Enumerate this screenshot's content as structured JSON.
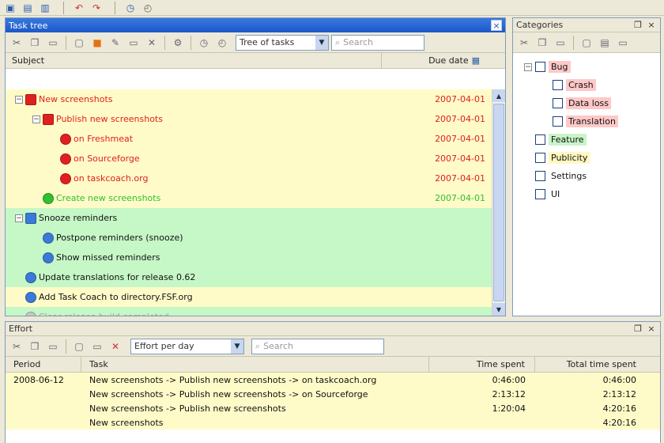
{
  "colors": {
    "overdue": "#e02020",
    "overdue_bg": "#fffbc8",
    "completed": "#30c030",
    "active_bg": "#c6f7c6",
    "inactive_bg": "#fffbc8",
    "task_blue": "#3a7ad8",
    "bug_bg": "#ffc8c8",
    "feature_bg": "#c8f5c8",
    "publicity_bg": "#fff8c0"
  },
  "main_toolbar": {
    "icons": [
      "save-icon",
      "open-icon",
      "print-icon",
      "undo-icon",
      "redo-icon",
      "clock-icon",
      "stopwatch-icon"
    ]
  },
  "task_tree": {
    "title": "Task tree",
    "view_select": "Tree of tasks",
    "search_placeholder": "Search",
    "col_subject": "Subject",
    "col_due": "Due date",
    "tasks": [
      {
        "label": "New screenshots",
        "due": "2007-04-01",
        "indent": 0,
        "expander": "−",
        "icon": "red-folder",
        "state": "overdue"
      },
      {
        "label": "Publish new screenshots",
        "due": "2007-04-01",
        "indent": 1,
        "expander": "−",
        "icon": "red-folder",
        "state": "overdue"
      },
      {
        "label": "on Freshmeat",
        "due": "2007-04-01",
        "indent": 2,
        "expander": "",
        "icon": "red",
        "state": "overdue"
      },
      {
        "label": "on Sourceforge",
        "due": "2007-04-01",
        "indent": 2,
        "expander": "",
        "icon": "red",
        "state": "overdue"
      },
      {
        "label": "on taskcoach.org",
        "due": "2007-04-01",
        "indent": 2,
        "expander": "",
        "icon": "red",
        "state": "overdue"
      },
      {
        "label": "Create new screenshots",
        "due": "2007-04-01",
        "indent": 1,
        "expander": "",
        "icon": "green",
        "state": "completed"
      },
      {
        "label": "Snooze reminders",
        "due": "",
        "indent": 0,
        "expander": "−",
        "icon": "blue-folder",
        "state": "active"
      },
      {
        "label": "Postpone reminders (snooze)",
        "due": "",
        "indent": 1,
        "expander": "",
        "icon": "blue",
        "state": "active"
      },
      {
        "label": "Show missed reminders",
        "due": "",
        "indent": 1,
        "expander": "",
        "icon": "blue",
        "state": "active"
      },
      {
        "label": "Update translations for release 0.62",
        "due": "",
        "indent": 0,
        "expander": "",
        "icon": "blue",
        "state": "active"
      },
      {
        "label": "Add Task Coach to directory.FSF.org",
        "due": "",
        "indent": 0,
        "expander": "",
        "icon": "blue",
        "state": "inactive"
      },
      {
        "label": "Clear release build completed",
        "due": "",
        "indent": 0,
        "expander": "",
        "icon": "grey",
        "state": "faded"
      }
    ]
  },
  "categories": {
    "title": "Categories",
    "items": [
      {
        "label": "Bug",
        "indent": 0,
        "expander": "−",
        "bg": "#ffc8c8"
      },
      {
        "label": "Crash",
        "indent": 1,
        "expander": "",
        "bg": "#ffc8c8"
      },
      {
        "label": "Data loss",
        "indent": 1,
        "expander": "",
        "bg": "#ffc8c8"
      },
      {
        "label": "Translation",
        "indent": 1,
        "expander": "",
        "bg": "#ffc8c8"
      },
      {
        "label": "Feature",
        "indent": 0,
        "expander": "",
        "bg": "#c8f5c8"
      },
      {
        "label": "Publicity",
        "indent": 0,
        "expander": "",
        "bg": "#fff8c0"
      },
      {
        "label": "Settings",
        "indent": 0,
        "expander": "",
        "bg": ""
      },
      {
        "label": "UI",
        "indent": 0,
        "expander": "",
        "bg": ""
      }
    ]
  },
  "effort": {
    "title": "Effort",
    "view_select": "Effort per day",
    "search_placeholder": "Search",
    "col_period": "Period",
    "col_task": "Task",
    "col_time_spent": "Time spent",
    "col_total_time_spent": "Total time spent",
    "rows": [
      {
        "period": "2008-06-12",
        "task": "New screenshots -> Publish new screenshots -> on taskcoach.org",
        "time": "0:46:00",
        "total": "0:46:00"
      },
      {
        "period": "",
        "task": "New screenshots -> Publish new screenshots -> on Sourceforge",
        "time": "2:13:12",
        "total": "2:13:12"
      },
      {
        "period": "",
        "task": "New screenshots -> Publish new screenshots",
        "time": "1:20:04",
        "total": "4:20:16"
      },
      {
        "period": "",
        "task": "New screenshots",
        "time": "",
        "total": "4:20:16"
      }
    ]
  }
}
